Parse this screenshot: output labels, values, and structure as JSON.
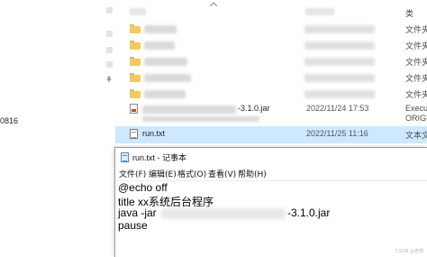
{
  "explorer": {
    "left_partial_text": "0816",
    "folder_type_label": "文件夹",
    "folder_row_count": 5,
    "jar_file": {
      "name_suffix": "-3.1.0.jar",
      "date": "2022/11/24 17:53",
      "type": "Executa"
    },
    "origin_row": {
      "type": "ORIGIN"
    },
    "txt_file": {
      "name": "run.txt",
      "date": "2022/11/25 11:16",
      "type": "文本文"
    },
    "header_type_label": "类"
  },
  "notepad": {
    "title": "run.txt - 记事本",
    "menu": [
      "文件(F)",
      "编辑(E)",
      "格式(O)",
      "查看(V)",
      "帮助(H)"
    ],
    "lines": {
      "echo": "@echo off",
      "title": "title xx系统后台程序",
      "java_prefix": "java -jar",
      "java_suffix": "-3.1.0.jar",
      "pause": "pause"
    }
  },
  "watermark": "CSDN @老郭",
  "colors": {
    "selection": "#cde8ff",
    "folder": "#f4c95d",
    "titlebar": "#ffffff"
  }
}
